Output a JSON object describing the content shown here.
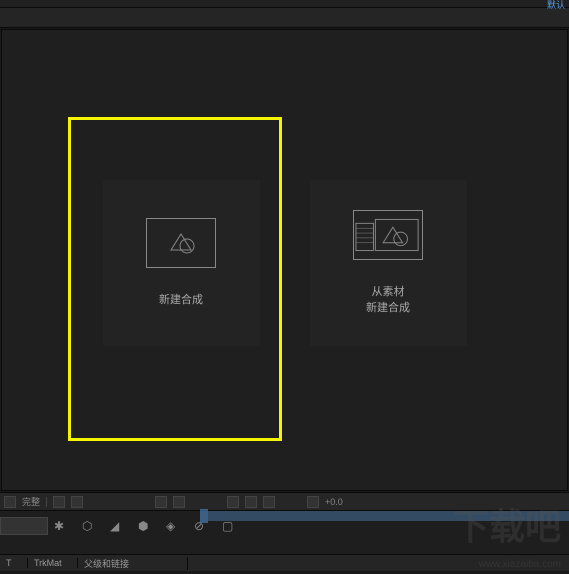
{
  "top": {
    "right_label": "默认"
  },
  "cards": {
    "new_comp": {
      "label": "新建合成"
    },
    "from_footage": {
      "line1": "从素材",
      "line2": "新建合成"
    }
  },
  "timeline": {
    "search_placeholder": "完整",
    "rotation_value": "+0.0",
    "col_t": "T",
    "col_trkmat": "TrkMat",
    "col_parent": "父级和链接"
  },
  "watermark": {
    "text": "下载吧",
    "url": "www.xiazaiba.com"
  }
}
